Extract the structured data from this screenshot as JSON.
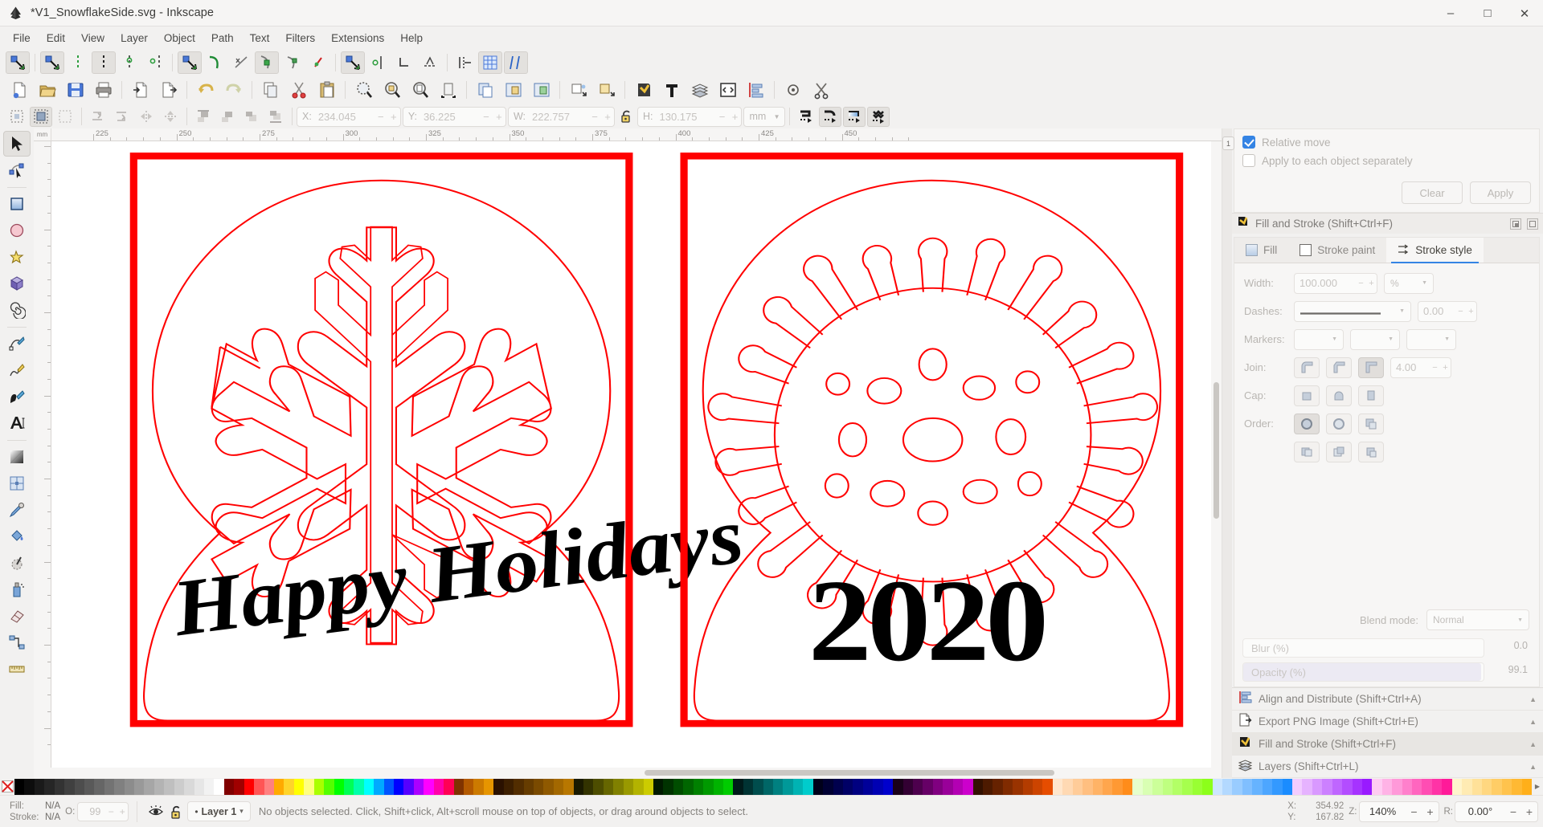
{
  "window": {
    "title": "*V1_SnowflakeSide.svg - Inkscape",
    "logo_icon": "inkscape-logo-icon",
    "minimize": "‒",
    "maximize": "□",
    "close": "✕"
  },
  "menubar": {
    "items": [
      {
        "label": "File"
      },
      {
        "label": "Edit"
      },
      {
        "label": "View"
      },
      {
        "label": "Layer"
      },
      {
        "label": "Object"
      },
      {
        "label": "Path"
      },
      {
        "label": "Text"
      },
      {
        "label": "Filters"
      },
      {
        "label": "Extensions"
      },
      {
        "label": "Help"
      }
    ]
  },
  "snap_toolbar": {
    "groups": [
      {
        "buttons": [
          {
            "name": "snap-enable-icon",
            "active": true
          },
          {
            "name": "snap-bounding-box-icon",
            "active": true
          },
          {
            "name": "snap-bbox-edge-icon",
            "active": false
          },
          {
            "name": "snap-bbox-corner-icon",
            "active": true
          },
          {
            "name": "snap-bbox-edge-midpoint-icon",
            "active": false
          },
          {
            "name": "snap-bbox-center-icon",
            "active": false
          }
        ]
      },
      {
        "buttons": [
          {
            "name": "snap-nodes-icon",
            "active": true
          },
          {
            "name": "snap-path-icon",
            "active": false
          },
          {
            "name": "snap-path-intersection-icon",
            "active": false
          },
          {
            "name": "snap-cusp-node-icon",
            "active": true
          },
          {
            "name": "snap-smooth-node-icon",
            "active": false
          },
          {
            "name": "snap-midpoint-icon",
            "active": false
          }
        ]
      },
      {
        "buttons": [
          {
            "name": "snap-others-icon",
            "active": true
          },
          {
            "name": "snap-object-center-icon",
            "active": false
          },
          {
            "name": "snap-rotation-center-icon",
            "active": false
          },
          {
            "name": "snap-text-baseline-icon",
            "active": false
          }
        ]
      },
      {
        "buttons": [
          {
            "name": "snap-page-border-icon",
            "active": false
          },
          {
            "name": "snap-grid-icon",
            "active": true
          },
          {
            "name": "snap-guide-icon",
            "active": true
          }
        ]
      }
    ]
  },
  "command_toolbar": {
    "buttons": [
      {
        "name": "new-document-icon"
      },
      {
        "name": "open-document-icon"
      },
      {
        "name": "save-document-icon"
      },
      {
        "name": "print-document-icon"
      },
      {
        "name": "import-icon"
      },
      {
        "name": "export-icon"
      },
      {
        "name": "undo-icon"
      },
      {
        "name": "redo-icon"
      },
      {
        "name": "copy-icon"
      },
      {
        "name": "cut-icon"
      },
      {
        "name": "paste-icon"
      },
      {
        "name": "zoom-selection-icon"
      },
      {
        "name": "zoom-drawing-icon"
      },
      {
        "name": "zoom-page-icon"
      },
      {
        "name": "zoom-page-width-icon"
      },
      {
        "name": "duplicate-icon"
      },
      {
        "name": "clone-icon"
      },
      {
        "name": "unlink-clone-icon"
      },
      {
        "name": "group-icon"
      },
      {
        "name": "ungroup-icon"
      },
      {
        "name": "xml-editor-icon"
      },
      {
        "name": "text-tool-icon"
      },
      {
        "name": "layers-icon"
      },
      {
        "name": "document-properties-icon"
      },
      {
        "name": "align-distribute-icon"
      },
      {
        "name": "preferences-icon"
      },
      {
        "name": "scissors-icon"
      }
    ]
  },
  "tool_controls": {
    "select_buttons": [
      {
        "name": "select-all-icon",
        "active": false
      },
      {
        "name": "select-all-layers-icon",
        "active": true
      },
      {
        "name": "deselect-icon",
        "active": false
      }
    ],
    "rotate_buttons": [
      {
        "name": "rotate-ccw-90-icon"
      },
      {
        "name": "rotate-cw-90-icon"
      },
      {
        "name": "flip-horizontal-icon"
      },
      {
        "name": "flip-vertical-icon"
      }
    ],
    "zorder_buttons": [
      {
        "name": "raise-to-top-icon"
      },
      {
        "name": "raise-icon"
      },
      {
        "name": "lower-icon"
      },
      {
        "name": "lower-to-bottom-icon"
      }
    ],
    "x": {
      "label": "X:",
      "value": "234.045"
    },
    "y": {
      "label": "Y:",
      "value": "36.225"
    },
    "w": {
      "label": "W:",
      "value": "222.757"
    },
    "h": {
      "label": "H:",
      "value": "130.175"
    },
    "lock_icon": "lock-wh-ratio-icon",
    "units": "mm",
    "affect_buttons": [
      {
        "name": "affect-stroke-width-icon",
        "active": false
      },
      {
        "name": "affect-rounded-corners-icon",
        "active": true
      },
      {
        "name": "affect-gradients-icon",
        "active": true
      },
      {
        "name": "affect-patterns-icon",
        "active": true
      }
    ]
  },
  "toolbox": {
    "tools": [
      {
        "name": "selector-tool",
        "icon": "arrow-cursor-icon",
        "active": true
      },
      {
        "name": "node-tool",
        "icon": "node-editor-icon",
        "active": false
      },
      {
        "name": "rectangle-tool",
        "icon": "square-icon",
        "active": false
      },
      {
        "name": "ellipse-tool",
        "icon": "circle-icon",
        "active": false
      },
      {
        "name": "star-tool",
        "icon": "star-icon",
        "active": false
      },
      {
        "name": "box3d-tool",
        "icon": "cube-icon",
        "active": false
      },
      {
        "name": "spiral-tool",
        "icon": "spiral-icon",
        "active": false
      },
      {
        "name": "bezier-tool",
        "icon": "pen-icon",
        "active": false
      },
      {
        "name": "pencil-tool",
        "icon": "pencil-icon",
        "active": false
      },
      {
        "name": "calligraphy-tool",
        "icon": "calligraphy-pen-icon",
        "active": false
      },
      {
        "name": "text-tool",
        "icon": "text-a-icon",
        "active": false
      },
      {
        "name": "gradient-tool",
        "icon": "gradient-icon",
        "active": false
      },
      {
        "name": "mesh-tool",
        "icon": "mesh-gradient-icon",
        "active": false
      },
      {
        "name": "dropper-tool",
        "icon": "eyedropper-icon",
        "active": false
      },
      {
        "name": "paintbucket-tool",
        "icon": "paint-bucket-icon",
        "active": false
      },
      {
        "name": "tweak-tool",
        "icon": "tweak-icon",
        "active": false
      },
      {
        "name": "spray-tool",
        "icon": "spray-can-icon",
        "active": false
      },
      {
        "name": "eraser-tool",
        "icon": "eraser-icon",
        "active": false
      },
      {
        "name": "connector-tool",
        "icon": "connector-icon",
        "active": false
      },
      {
        "name": "measure-tool",
        "icon": "measure-ruler-icon",
        "active": false
      }
    ]
  },
  "rulers": {
    "horizontal_labels": [
      "225",
      "250",
      "275",
      "300",
      "325",
      "350",
      "375",
      "400",
      "425",
      "450"
    ],
    "unit": "mm"
  },
  "canvas": {
    "documents": [
      {
        "name": "snowflake-ornament",
        "caption": "Happy Holidays",
        "motif": "snowflake"
      },
      {
        "name": "virus-ornament",
        "caption": "2020",
        "motif": "coronavirus"
      }
    ],
    "stroke_color": "#ff0000",
    "text_color": "#000000"
  },
  "transform_panel": {
    "relative_move": {
      "label": "Relative move",
      "checked": true
    },
    "apply_each": {
      "label": "Apply to each object separately",
      "checked": false
    },
    "clear_label": "Clear",
    "apply_label": "Apply"
  },
  "fill_stroke_panel": {
    "header": "Fill and Stroke (Shift+Ctrl+F)",
    "header_icon": "fill-stroke-brush-icon",
    "tabs": [
      {
        "label": "Fill",
        "icon": "fill-swatch-icon",
        "active": false
      },
      {
        "label": "Stroke paint",
        "icon": "stroke-swatch-icon",
        "active": false
      },
      {
        "label": "Stroke style",
        "icon": "stroke-style-icon",
        "active": true
      }
    ],
    "width": {
      "label": "Width:",
      "value": "100.000",
      "unit": "%"
    },
    "dashes": {
      "label": "Dashes:",
      "offset": "0.00"
    },
    "markers": {
      "label": "Markers:"
    },
    "join": {
      "label": "Join:",
      "miter": "4.00",
      "options": [
        "round-join-icon",
        "bevel-join-icon",
        "miter-join-icon"
      ],
      "selected": 2
    },
    "cap": {
      "label": "Cap:",
      "options": [
        "butt-cap-icon",
        "round-cap-icon",
        "square-cap-icon"
      ],
      "selected": 0
    },
    "order": {
      "label": "Order:",
      "options": [
        "fill-markers-stroke-icon",
        "fill-stroke-markers-icon",
        "stroke-fill-markers-icon",
        "markers-fill-stroke-icon",
        "markers-stroke-fill-icon",
        "stroke-markers-fill-icon"
      ],
      "selected": 0
    },
    "blend_mode": {
      "label": "Blend mode:",
      "value": "Normal"
    },
    "blur": {
      "label": "Blur (%)",
      "value": "0.0"
    },
    "opacity": {
      "label": "Opacity (%)",
      "value": "99.1"
    }
  },
  "dialog_list": {
    "items": [
      {
        "label": "Align and Distribute (Shift+Ctrl+A)",
        "icon": "align-distribute-icon",
        "selected": false
      },
      {
        "label": "Export PNG Image (Shift+Ctrl+E)",
        "icon": "export-png-icon",
        "selected": false
      },
      {
        "label": "Fill and Stroke (Shift+Ctrl+F)",
        "icon": "fill-stroke-brush-icon",
        "selected": true
      },
      {
        "label": "Layers (Shift+Ctrl+L)",
        "icon": "layers-stack-icon",
        "selected": false
      }
    ],
    "chevron": "▲"
  },
  "palette": {
    "none_icon": "no-color-x-icon",
    "scroll_arrow": "▶",
    "colors": [
      "#000000",
      "#0d0d0d",
      "#1a1a1a",
      "#262626",
      "#333333",
      "#404040",
      "#4d4d4d",
      "#595959",
      "#666666",
      "#737373",
      "#808080",
      "#8c8c8c",
      "#999999",
      "#a6a6a6",
      "#b3b3b3",
      "#bfbfbf",
      "#cccccc",
      "#d9d9d9",
      "#e6e6e6",
      "#f2f2f2",
      "#ffffff",
      "#800000",
      "#a00000",
      "#ff0000",
      "#ff5555",
      "#ff8080",
      "#ffaa00",
      "#ffd42a",
      "#ffff00",
      "#ffff80",
      "#aaff00",
      "#55ff00",
      "#00ff00",
      "#00ff55",
      "#00ffaa",
      "#00ffff",
      "#00aaff",
      "#0055ff",
      "#0000ff",
      "#5500ff",
      "#aa00ff",
      "#ff00ff",
      "#ff00aa",
      "#ff0055",
      "#803300",
      "#b35900",
      "#cc7a00",
      "#e69500",
      "#2b1100",
      "#3d1f00",
      "#522d00",
      "#663c00",
      "#7a4a00",
      "#8f5900",
      "#a36800",
      "#b87700",
      "#1a1a00",
      "#333300",
      "#4d4d00",
      "#666600",
      "#808000",
      "#999900",
      "#b3b300",
      "#cccc00",
      "#001a00",
      "#003300",
      "#004d00",
      "#006600",
      "#008000",
      "#009900",
      "#00b300",
      "#00cc00",
      "#001a1a",
      "#003333",
      "#004d4d",
      "#006666",
      "#008080",
      "#009999",
      "#00b3b3",
      "#00cccc",
      "#00001a",
      "#000033",
      "#00004d",
      "#000066",
      "#000080",
      "#000099",
      "#0000b3",
      "#0000cc",
      "#1a001a",
      "#330033",
      "#4d004d",
      "#660066",
      "#800080",
      "#990099",
      "#b300b3",
      "#cc00cc",
      "#331100",
      "#4d1a00",
      "#662200",
      "#802b00",
      "#993300",
      "#b33c00",
      "#cc4400",
      "#e64d00",
      "#ffe6cc",
      "#ffd9b3",
      "#ffcc99",
      "#ffbf80",
      "#ffb366",
      "#ffa64d",
      "#ff9933",
      "#ff8c1a",
      "#e6ffcc",
      "#d9ffb3",
      "#ccff99",
      "#bfff80",
      "#b3ff66",
      "#a6ff4d",
      "#99ff33",
      "#8cff1a",
      "#cce6ff",
      "#b3d9ff",
      "#99ccff",
      "#80bfff",
      "#66b3ff",
      "#4da6ff",
      "#3399ff",
      "#1a8cff",
      "#f2ccff",
      "#e6b3ff",
      "#d999ff",
      "#cc80ff",
      "#bf66ff",
      "#b34dff",
      "#a633ff",
      "#991aff",
      "#ffccf2",
      "#ffb3e6",
      "#ff99d9",
      "#ff80cc",
      "#ff66bf",
      "#ff4db3",
      "#ff33a6",
      "#ff1a99",
      "#fff5cc",
      "#ffebb3",
      "#ffe199",
      "#ffd780",
      "#ffcd66",
      "#ffc34d",
      "#ffb933",
      "#ffaf1a"
    ]
  },
  "statusbar": {
    "fill": {
      "label": "Fill:",
      "value": "N/A"
    },
    "stroke": {
      "label": "Stroke:",
      "value": "N/A"
    },
    "opacity": {
      "label": "O:",
      "value": "99"
    },
    "visibility_icon": "eye-icon",
    "lock_icon": "unlocked-padlock-icon",
    "layer": {
      "name": "Layer 1",
      "chevron": "▾",
      "bullet": "•"
    },
    "message": "No objects selected. Click, Shift+click, Alt+scroll mouse on top of objects, or drag around objects to select.",
    "cursor": {
      "x_label": "X:",
      "x_value": "354.92",
      "y_label": "Y:",
      "y_value": "167.82"
    },
    "zoom": {
      "label": "Z:",
      "value": "140%",
      "minus": "−",
      "plus": "+"
    },
    "rotation": {
      "label": "R:",
      "value": "0.00°",
      "minus": "−",
      "plus": "+"
    }
  }
}
